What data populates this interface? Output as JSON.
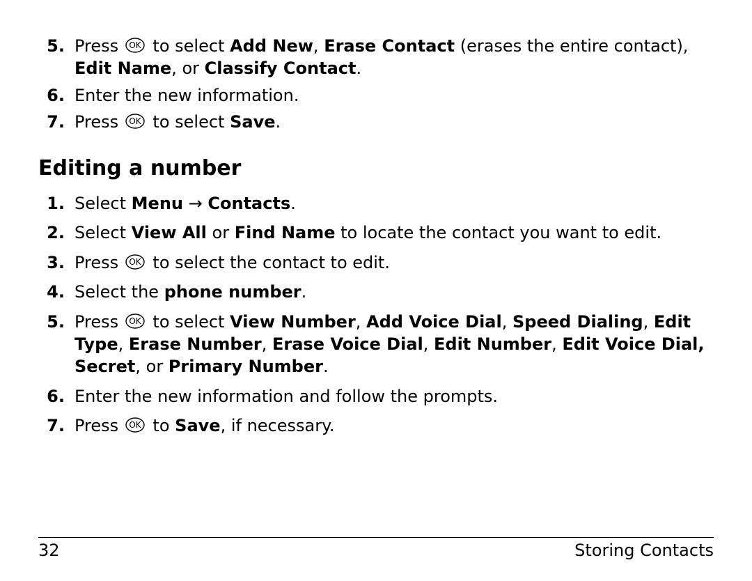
{
  "ok_label": "OK",
  "list1": {
    "items": [
      {
        "num": "5.",
        "parts": [
          "Press ",
          "{OK}",
          " to select ",
          {
            "b": "Add New"
          },
          ", ",
          {
            "b": "Erase Contact"
          },
          " (erases the entire contact), ",
          {
            "b": "Edit Name"
          },
          ", or ",
          {
            "b": "Classify Contact"
          },
          "."
        ]
      },
      {
        "num": "6.",
        "parts": [
          "Enter the new information."
        ]
      },
      {
        "num": "7.",
        "parts": [
          "Press ",
          "{OK}",
          " to select ",
          {
            "b": "Save"
          },
          "."
        ]
      }
    ]
  },
  "section_heading": "Editing a number",
  "list2": {
    "items": [
      {
        "num": "1.",
        "parts": [
          "Select ",
          {
            "b": "Menu"
          },
          " → ",
          {
            "b": "Contacts"
          },
          "."
        ]
      },
      {
        "num": "2.",
        "parts": [
          "Select ",
          {
            "b": "View All"
          },
          " or ",
          {
            "b": "Find Name"
          },
          " to locate the contact you want to edit."
        ]
      },
      {
        "num": "3.",
        "parts": [
          "Press ",
          "{OK}",
          " to select the contact to edit."
        ]
      },
      {
        "num": "4.",
        "parts": [
          "Select the ",
          {
            "b": "phone number"
          },
          "."
        ]
      },
      {
        "num": "5.",
        "parts": [
          "Press ",
          "{OK}",
          " to select ",
          {
            "b": "View Number"
          },
          ", ",
          {
            "b": "Add Voice Dial"
          },
          ", ",
          {
            "b": "Speed Dialing"
          },
          ", ",
          {
            "b": "Edit Type"
          },
          ", ",
          {
            "b": "Erase Number"
          },
          ", ",
          {
            "b": "Erase Voice Dial"
          },
          ", ",
          {
            "b": "Edit Number"
          },
          ", ",
          {
            "b": "Edit Voice Dial, Secret"
          },
          ", or ",
          {
            "b": "Primary Number"
          },
          "."
        ]
      },
      {
        "num": "6.",
        "parts": [
          "Enter the new information and follow the prompts."
        ]
      },
      {
        "num": "7.",
        "parts": [
          "Press ",
          "{OK}",
          " to ",
          {
            "b": "Save"
          },
          ", if necessary."
        ]
      }
    ]
  },
  "footer": {
    "page_number": "32",
    "section": "Storing Contacts"
  }
}
